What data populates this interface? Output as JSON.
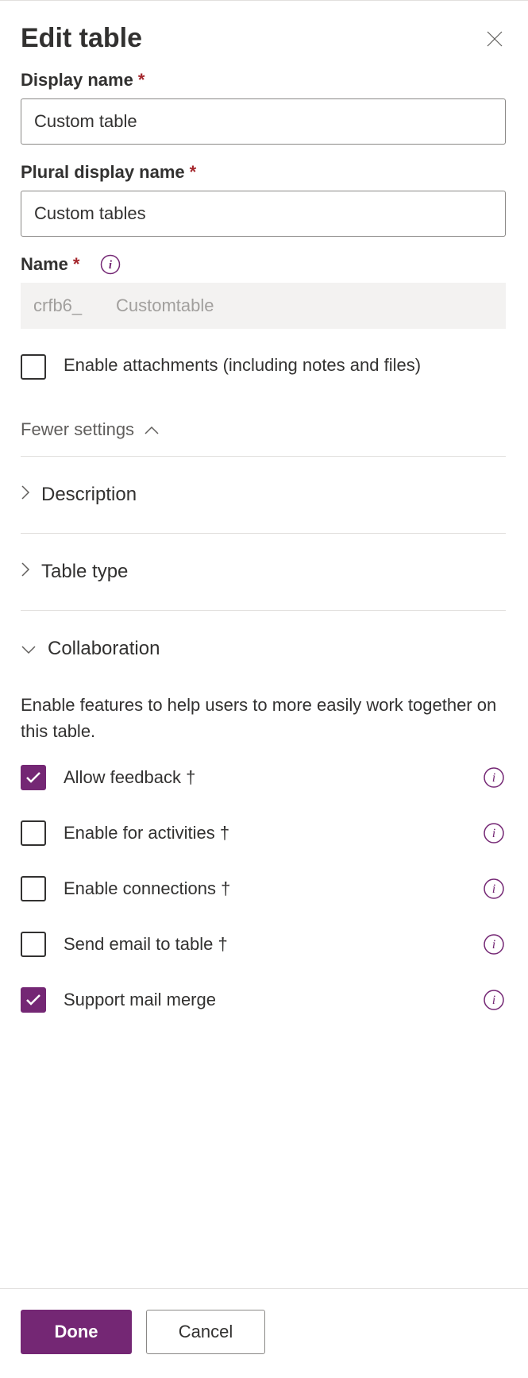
{
  "header": {
    "title": "Edit table"
  },
  "fields": {
    "display_name": {
      "label": "Display name",
      "value": "Custom table"
    },
    "plural_display_name": {
      "label": "Plural display name",
      "value": "Custom tables"
    },
    "name": {
      "label": "Name",
      "prefix": "crfb6_",
      "value": "Customtable"
    },
    "enable_attachments": {
      "label": "Enable attachments (including notes and files)",
      "checked": false
    }
  },
  "toggle": {
    "label": "Fewer settings"
  },
  "sections": {
    "description": {
      "title": "Description",
      "expanded": false
    },
    "table_type": {
      "title": "Table type",
      "expanded": false
    },
    "collaboration": {
      "title": "Collaboration",
      "expanded": true,
      "description": "Enable features to help users to more easily work together on this table.",
      "items": [
        {
          "label": "Allow feedback †",
          "checked": true
        },
        {
          "label": "Enable for activities †",
          "checked": false
        },
        {
          "label": "Enable connections †",
          "checked": false
        },
        {
          "label": "Send email to table †",
          "checked": false
        },
        {
          "label": "Support mail merge",
          "checked": true
        }
      ]
    }
  },
  "footer": {
    "primary": "Done",
    "secondary": "Cancel"
  }
}
